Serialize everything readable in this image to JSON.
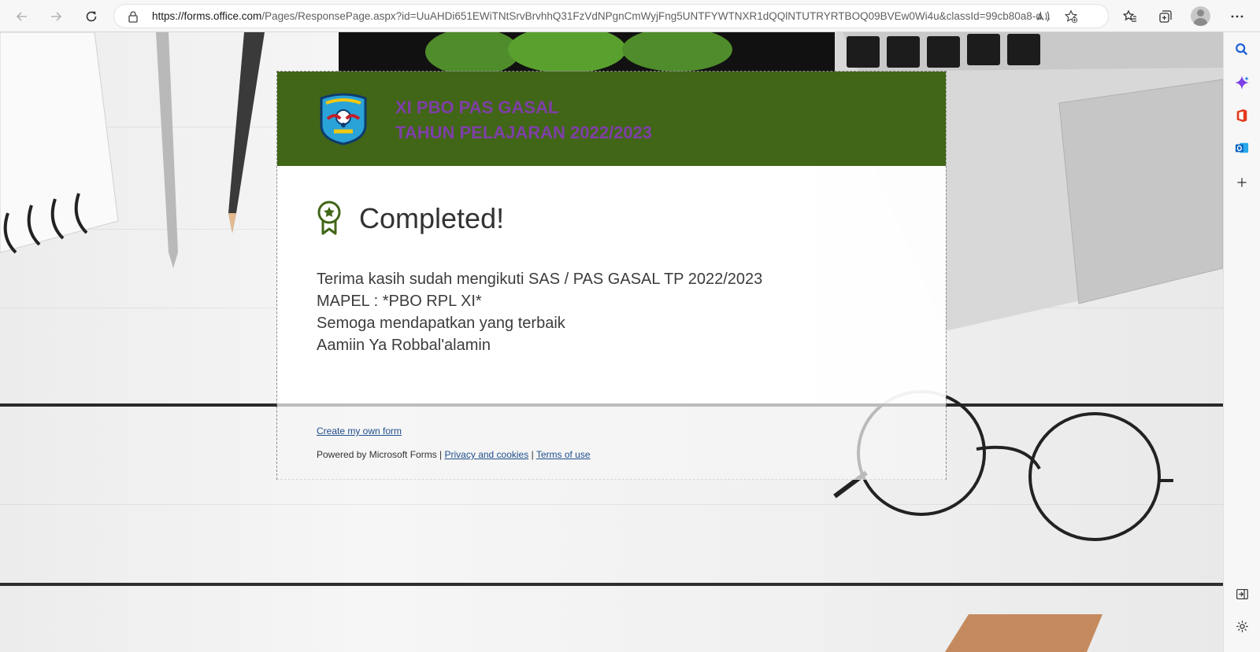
{
  "browser": {
    "url_host": "https://forms.office.com",
    "url_path": "/Pages/ResponsePage.aspx?id=UuAHDi651EWiTNtSrvBrvhhQ31FzVdNPgnCmWyjFng5UNTFYWTNXR1dQQlNTUTRYRTBOQ09BVEw0Wi4u&classId=99cb80a8-d...",
    "icons": [
      "back-icon",
      "forward-icon",
      "refresh-icon",
      "lock-icon",
      "read-aloud-icon",
      "add-favorite-icon",
      "favorites-icon",
      "collections-icon",
      "profile-avatar",
      "more-icon"
    ]
  },
  "sidebar": {
    "icons": [
      "search-icon",
      "copilot-icon",
      "office-icon",
      "outlook-icon",
      "add-icon",
      "hide-sidebar-icon",
      "settings-icon"
    ]
  },
  "form": {
    "title_line1": "XI PBO PAS GASAL",
    "title_line2": "TAHUN PELAJARAN 2022/2023",
    "status": "Completed!",
    "message_lines": [
      "Terima kasih sudah mengikuti SAS / PAS GASAL TP 2022/2023",
      "MAPEL : *PBO RPL XI*",
      "Semoga mendapatkan yang terbaik",
      "Aamiin Ya Robbal'alamin"
    ],
    "header_color": "#416617",
    "title_color": "#7e3fa6"
  },
  "footer": {
    "create_link": "Create my own form",
    "powered_by": "Powered by Microsoft Forms |",
    "privacy": "Privacy and cookies",
    "separator": "|",
    "terms": "Terms of use"
  }
}
